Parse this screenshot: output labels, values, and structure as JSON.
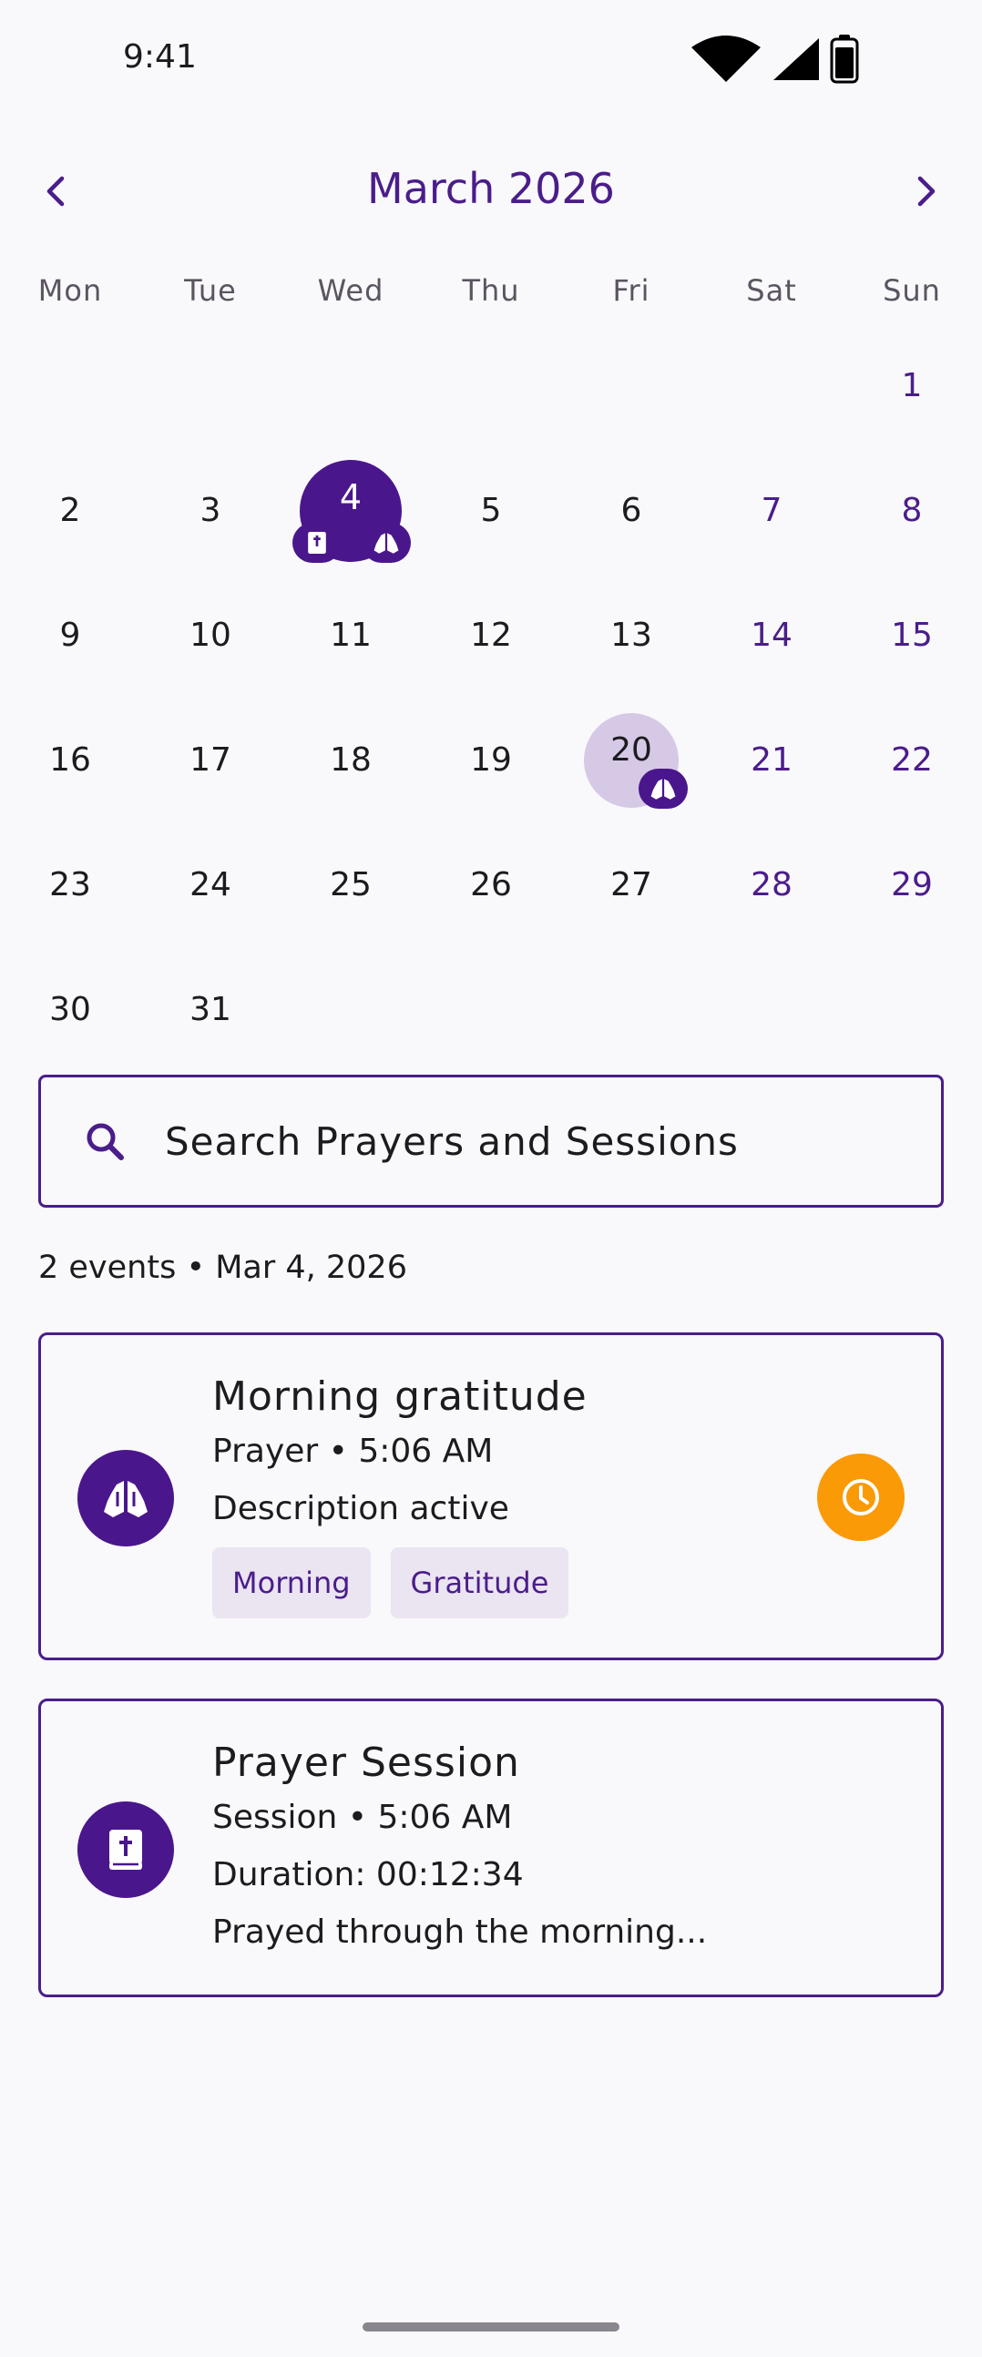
{
  "status_bar": {
    "time": "9:41"
  },
  "calendar": {
    "month_title": "March 2026",
    "weekdays": [
      "Mon",
      "Tue",
      "Wed",
      "Thu",
      "Fri",
      "Sat",
      "Sun"
    ],
    "weeks": [
      [
        "",
        "",
        "",
        "",
        "",
        "",
        "1"
      ],
      [
        "2",
        "3",
        "4",
        "5",
        "6",
        "7",
        "8"
      ],
      [
        "9",
        "10",
        "11",
        "12",
        "13",
        "14",
        "15"
      ],
      [
        "16",
        "17",
        "18",
        "19",
        "20",
        "21",
        "22"
      ],
      [
        "23",
        "24",
        "25",
        "26",
        "27",
        "28",
        "29"
      ],
      [
        "30",
        "31",
        "",
        "",
        "",
        "",
        ""
      ]
    ],
    "selected_day": "4",
    "event_days": [
      "20"
    ],
    "colors": {
      "primary": "#4a168c",
      "marked": "#d6c9e6",
      "accent": "#fa9a07"
    }
  },
  "search": {
    "placeholder": "Search Prayers and Sessions"
  },
  "events_summary": "2 events • Mar 4, 2026",
  "events": [
    {
      "title": "Morning gratitude",
      "line1": "Prayer • 5:06 AM",
      "line2": "Description active",
      "tags": [
        "Morning",
        "Gratitude"
      ],
      "icon": "praying-hands-icon",
      "action_icon": "clock-icon"
    },
    {
      "title": "Prayer Session",
      "line1": "Session • 5:06 AM",
      "line2": "Duration: 00:12:34",
      "line3": "Prayed through the morning...",
      "icon": "bible-icon"
    }
  ]
}
